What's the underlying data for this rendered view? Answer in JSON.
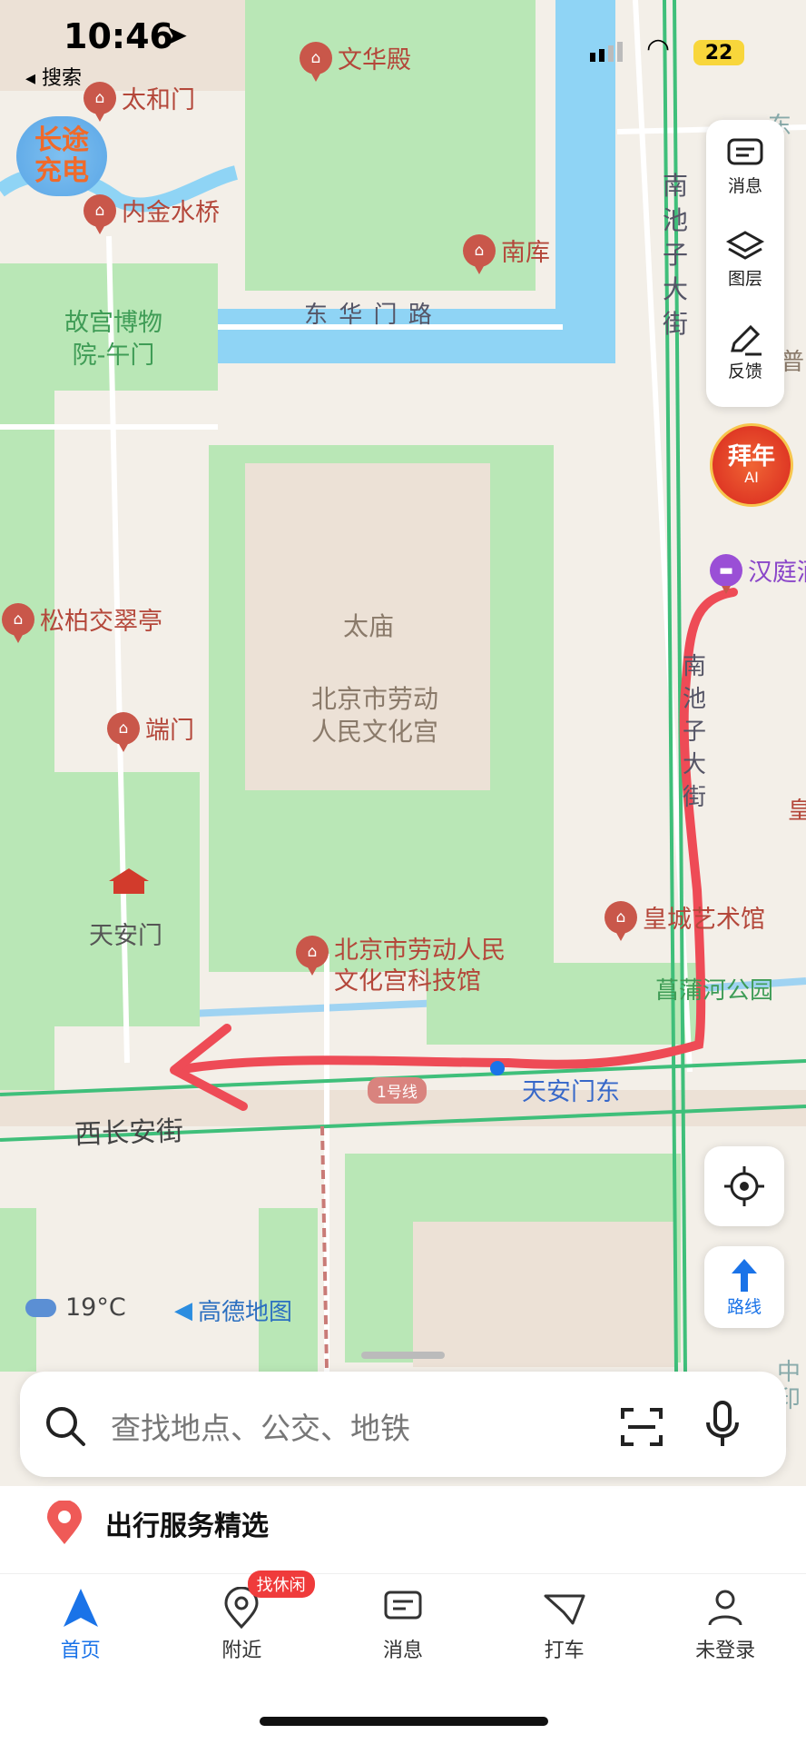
{
  "status": {
    "time": "10:46",
    "back_label": "◂ 搜索",
    "battery": "22"
  },
  "map": {
    "pois": [
      "文华殿",
      "太和门",
      "内金水桥",
      "南库",
      "松柏交翠亭",
      "端门",
      "北京市劳动人民文化宫科技馆",
      "皇城艺术馆",
      "汉庭酒"
    ],
    "area_labels": {
      "gugong_wumen": "故宫博物院-午门",
      "taimiao": "太庙",
      "laodong_line1": "北京市劳动",
      "laodong_line2": "人民文化宫",
      "tiananmen": "天安门",
      "changyu_park": "菖蒲河公园"
    },
    "roads": {
      "donghuamen": "东 华 门 路",
      "nanchizi": "南池子大街",
      "nanchizi2": "南池子大街",
      "xichanganjie": "西长安街",
      "metro_line": "1号线",
      "station": "天安门东"
    },
    "badge_changtu_line1": "长途",
    "badge_changtu_line2": "充电",
    "weather": "19°C",
    "brand": "高德地图",
    "partial_right_1": "东",
    "partial_right_2": "普",
    "partial_right_3": "皇",
    "partial_right_4": "中",
    "partial_right_5": "印"
  },
  "right_panel": {
    "messages": "消息",
    "layers": "图层",
    "feedback": "反馈"
  },
  "bainian": {
    "line1": "拜年",
    "line2": "AI"
  },
  "route_button": "路线",
  "search": {
    "placeholder": "查找地点、公交、地铁"
  },
  "section_title": "出行服务精选",
  "tabs": [
    {
      "label": "首页",
      "active": true
    },
    {
      "label": "附近",
      "badge": "找休闲"
    },
    {
      "label": "消息"
    },
    {
      "label": "打车"
    },
    {
      "label": "未登录"
    }
  ],
  "colors": {
    "accent": "#1a73e8",
    "route": "#ee4b56",
    "water": "#8fd4f5",
    "green": "#b5e6b5"
  }
}
